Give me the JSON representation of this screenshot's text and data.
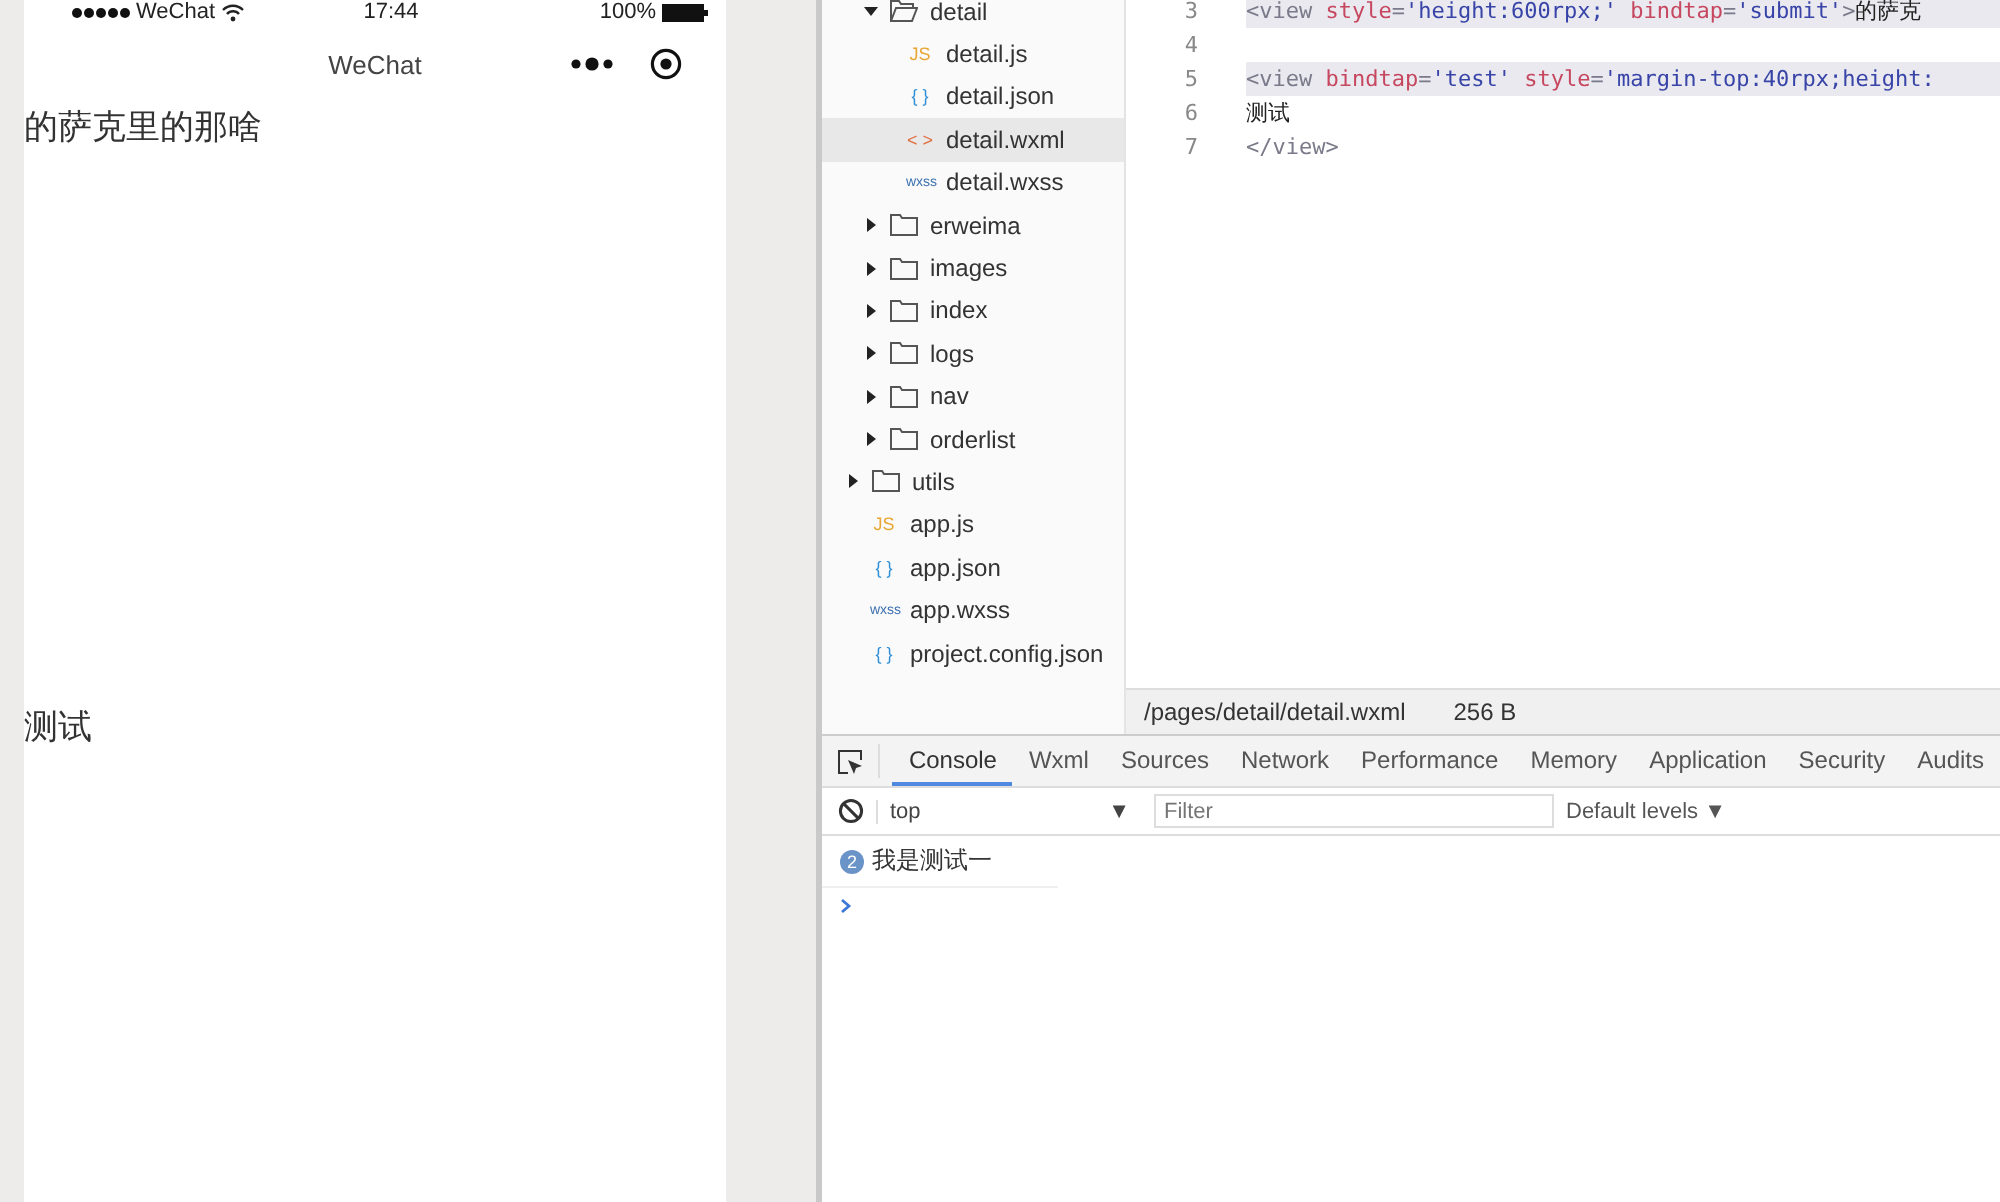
{
  "phone": {
    "status_bar": {
      "carrier": "WeChat",
      "time": "17:44",
      "battery": "100%"
    },
    "nav_title": "WeChat",
    "views": [
      {
        "text": "的萨克里的那啥",
        "kind": "tall"
      },
      {
        "text": "测试",
        "kind": "plain"
      }
    ]
  },
  "file_tree": {
    "items": [
      {
        "children": [
          {
            "label": "detail",
            "kind": "folder",
            "expanded": true,
            "selected": false,
            "children": [
              {
                "label": "detail.js",
                "kind": "js",
                "icon_text": "JS",
                "selected": false
              },
              {
                "label": "detail.json",
                "kind": "json",
                "icon_text": "{ }",
                "selected": false
              },
              {
                "label": "detail.wxml",
                "kind": "wxml",
                "icon_text": "< >",
                "selected": true
              },
              {
                "label": "detail.wxss",
                "kind": "wxss",
                "icon_text": "wxss",
                "selected": false
              }
            ]
          },
          {
            "label": "erweima",
            "kind": "folder",
            "expanded": false,
            "selected": false
          },
          {
            "label": "images",
            "kind": "folder",
            "expanded": false,
            "selected": false
          },
          {
            "label": "index",
            "kind": "folder",
            "expanded": false,
            "selected": false
          },
          {
            "label": "logs",
            "kind": "folder",
            "expanded": false,
            "selected": false
          },
          {
            "label": "nav",
            "kind": "folder",
            "expanded": false,
            "selected": false
          },
          {
            "label": "orderlist",
            "kind": "folder",
            "expanded": false,
            "selected": false
          }
        ]
      },
      {
        "label": "utils",
        "kind": "folder",
        "expanded": false,
        "selected": false
      },
      {
        "label": "app.js",
        "kind": "js",
        "icon_text": "JS",
        "selected": false
      },
      {
        "label": "app.json",
        "kind": "json",
        "icon_text": "{ }",
        "selected": false
      },
      {
        "label": "app.wxss",
        "kind": "wxss",
        "icon_text": "wxss",
        "selected": false
      },
      {
        "label": "project.config.json",
        "kind": "json",
        "icon_text": "{ }",
        "selected": false
      }
    ]
  },
  "editor": {
    "lines": [
      {
        "number": "3",
        "highlighted": true,
        "tokens": [
          {
            "kind": "tag",
            "text": "<view "
          },
          {
            "kind": "attr",
            "text": "style"
          },
          {
            "kind": "tag",
            "text": "="
          },
          {
            "kind": "value",
            "text": "'height:600rpx;'"
          },
          {
            "kind": "attr",
            "text": " bindtap"
          },
          {
            "kind": "tag",
            "text": "="
          },
          {
            "kind": "value",
            "text": "'submit'"
          },
          {
            "kind": "tag",
            "text": ">"
          },
          {
            "kind": "text",
            "text": "的萨克"
          }
        ]
      },
      {
        "number": "4",
        "highlighted": false
      },
      {
        "number": "5",
        "highlighted": true,
        "tokens": [
          {
            "kind": "tag",
            "text": "<view "
          },
          {
            "kind": "attr",
            "text": "bindtap"
          },
          {
            "kind": "tag",
            "text": "="
          },
          {
            "kind": "value",
            "text": "'test'"
          },
          {
            "kind": "attr",
            "text": " style"
          },
          {
            "kind": "tag",
            "text": "="
          },
          {
            "kind": "value",
            "text": "'margin-top:40rpx;height:"
          }
        ]
      },
      {
        "number": "6",
        "highlighted": false,
        "tokens": [
          {
            "kind": "text",
            "text": "测试"
          }
        ]
      },
      {
        "number": "7",
        "highlighted": false,
        "tokens": [
          {
            "kind": "tag",
            "text": "</view>"
          }
        ]
      }
    ],
    "status_bar": {
      "path": "/pages/detail/detail.wxml",
      "size": "256 B"
    }
  },
  "devtools": {
    "tabs": [
      {
        "label": "Console",
        "selected": true
      },
      {
        "label": "Wxml",
        "selected": false
      },
      {
        "label": "Sources",
        "selected": false
      },
      {
        "label": "Network",
        "selected": false
      },
      {
        "label": "Performance",
        "selected": false
      },
      {
        "label": "Memory",
        "selected": false
      },
      {
        "label": "Application",
        "selected": false
      },
      {
        "label": "Security",
        "selected": false
      },
      {
        "label": "Audits",
        "selected": false
      }
    ],
    "context": "top",
    "filter_placeholder": "Filter",
    "levels": "Default levels ▼",
    "context_caret": "▼",
    "messages": [
      {
        "count": "2",
        "text": "我是测试一"
      }
    ]
  }
}
